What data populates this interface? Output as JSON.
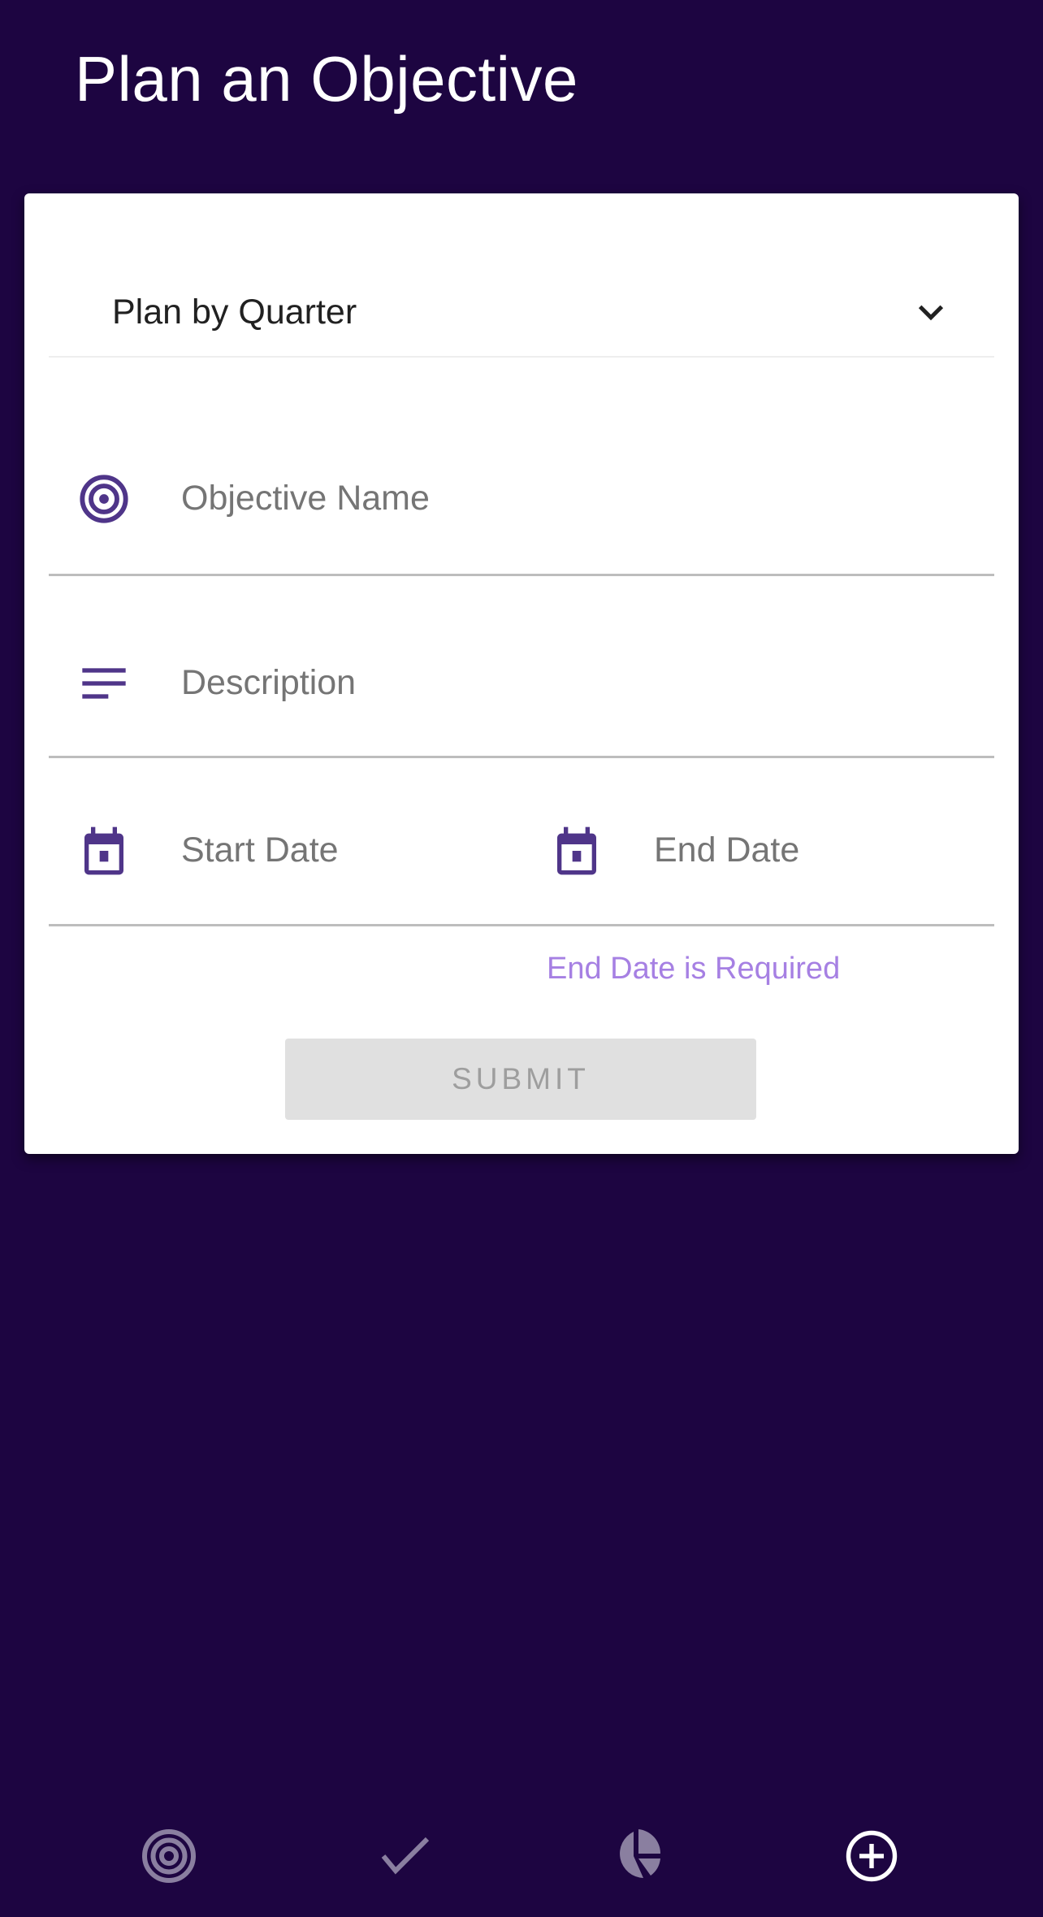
{
  "header": {
    "title": "Plan an Objective"
  },
  "form": {
    "plan_select": {
      "value": "Plan by Quarter",
      "icon": "chevron-down-icon"
    },
    "objective_name": {
      "placeholder": "Objective Name",
      "icon": "target-icon"
    },
    "description": {
      "placeholder": "Description",
      "icon": "notes-icon"
    },
    "start_date": {
      "placeholder": "Start Date",
      "icon": "calendar-icon"
    },
    "end_date": {
      "placeholder": "End Date",
      "icon": "calendar-icon"
    },
    "error": "End Date is Required",
    "submit_label": "SUBMIT"
  },
  "bottom_nav": {
    "items": [
      {
        "icon": "target-icon",
        "active": false
      },
      {
        "icon": "check-icon",
        "active": false
      },
      {
        "icon": "pie-chart-icon",
        "active": false
      },
      {
        "icon": "add-circle-icon",
        "active": true
      }
    ]
  },
  "colors": {
    "background": "#1d0541",
    "accent": "#4f3589",
    "error": "#a680e3",
    "nav_inactive": "#8a7fa0",
    "nav_active": "#ffffff"
  }
}
